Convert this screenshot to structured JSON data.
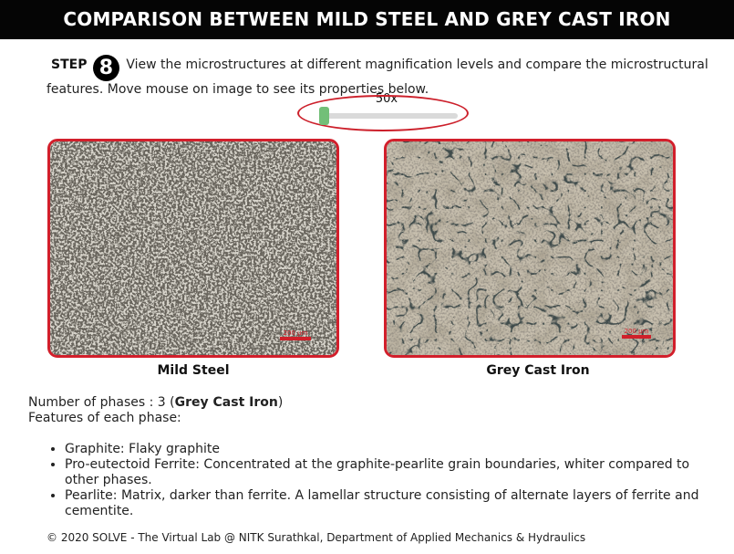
{
  "title": "COMPARISON BETWEEN MILD STEEL AND GREY CAST IRON",
  "step": {
    "label": "STEP",
    "number": "8",
    "instruction": "View the microstructures at different magnification levels and compare the microstructural features. Move mouse on image to see its properties below."
  },
  "magnification": {
    "current_label": "50x",
    "slider_position": 0
  },
  "images": {
    "left": {
      "caption": "Mild Steel",
      "scale_bar": "200 μm"
    },
    "right": {
      "caption": "Grey Cast Iron",
      "scale_bar": "200 μm"
    }
  },
  "properties": {
    "phase_count_prefix": "Number of phases : 3 (",
    "phase_material": "Grey Cast Iron",
    "phase_count_suffix": ")",
    "features_heading": "Features of each phase:",
    "features": [
      "Graphite: Flaky graphite",
      "Pro-eutectoid Ferrite: Concentrated at the graphite-pearlite grain boundaries, whiter compared to other phases.",
      "Pearlite: Matrix, darker than ferrite. A lamellar structure consisting of alternate layers of ferrite and cementite."
    ]
  },
  "footer": "© 2020 SOLVE - The Virtual Lab @ NITK Surathkal, Department of Applied Mechanics & Hydraulics",
  "colors": {
    "title_bg": "#050505",
    "highlight_red": "#cc1f2a",
    "slider_thumb": "#72bf78"
  }
}
